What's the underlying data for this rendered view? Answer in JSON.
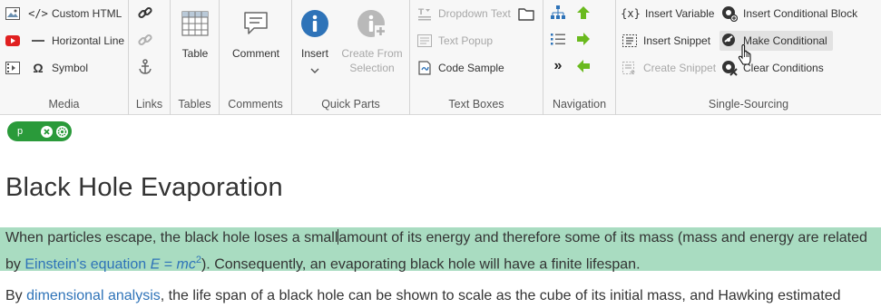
{
  "ribbon": {
    "media": {
      "label": "Media",
      "items": [
        {
          "label": "Custom HTML",
          "icon": "code-icon"
        },
        {
          "label": "Horizontal Line",
          "icon": "horizontal-line-icon"
        },
        {
          "label": "Symbol",
          "icon": "omega-icon"
        }
      ]
    },
    "links": {
      "label": "Links"
    },
    "tables": {
      "label": "Tables",
      "table_label": "Table"
    },
    "comments": {
      "label": "Comments",
      "comment_label": "Comment"
    },
    "quick_parts": {
      "label": "Quick Parts",
      "insert_label": "Insert",
      "create_label_1": "Create From",
      "create_label_2": "Selection"
    },
    "text_boxes": {
      "label": "Text Boxes",
      "items": [
        {
          "label": "Dropdown Text",
          "disabled": true
        },
        {
          "label": "Text Popup",
          "disabled": true
        },
        {
          "label": "Code Sample",
          "disabled": false
        }
      ]
    },
    "navigation": {
      "label": "Navigation"
    },
    "single_sourcing": {
      "label": "Single-Sourcing",
      "items": [
        {
          "label": "Insert Variable",
          "disabled": false
        },
        {
          "label": "Insert Snippet",
          "disabled": false
        },
        {
          "label": "Create Snippet",
          "disabled": true
        },
        {
          "label": "Insert Conditional Block",
          "disabled": false
        },
        {
          "label": "Make Conditional",
          "disabled": false
        },
        {
          "label": "Clear Conditions",
          "disabled": false
        }
      ]
    }
  },
  "tagbar": {
    "tag": "p"
  },
  "colors": {
    "accent_green": "#2a9a3a",
    "highlight": "#a9dcc1",
    "link": "#2e73b8",
    "info_blue": "#2e73b8",
    "arrow_green": "#6aba1e"
  },
  "document": {
    "title": "Black Hole Evaporation",
    "p1": {
      "t1": "When particles escape, the black hole loses a small",
      "t2": "amount of its energy and therefore some of its mass (mass and energy are related by ",
      "link": "Einstein's equation",
      "eq1": "E",
      "eq2": " = ",
      "eq3": "mc",
      "sup": "2",
      "t3": "). Consequently, an evaporating black hole will have a finite lifespan."
    },
    "p2": {
      "t1": "By ",
      "link": "dimensional analysis",
      "t2": ", the life span of a black hole can be shown to scale as the cube of its initial mass, and Hawking estimated"
    }
  }
}
